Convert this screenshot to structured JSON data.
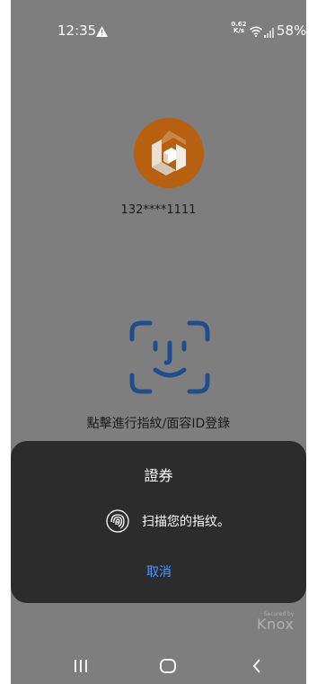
{
  "status_bar": {
    "time": "12:35",
    "net_speed_value": "0.62",
    "net_speed_unit": "K/s",
    "battery": "58%"
  },
  "account": {
    "phone_masked": "132****1111"
  },
  "login": {
    "prompt": "點擊進行指紋/面容ID登錄"
  },
  "dialog": {
    "title": "證券",
    "message": "扫描您的指纹。",
    "cancel_label": "取消"
  },
  "footer": {
    "knox_secured": "Secured by",
    "knox_brand": "Knox"
  },
  "colors": {
    "background": "#7e7e7e",
    "dialog": "#2c2c2c",
    "accent_link": "#4f98ff",
    "logo_orange": "#b7600f",
    "face_icon_blue": "#1f4e8c"
  },
  "icons": {
    "warning": "warning-icon",
    "wifi": "wifi-icon",
    "signal": "signal-icon",
    "battery": "battery-icon",
    "fingerprint": "fingerprint-icon",
    "face_id": "face-id-icon"
  }
}
